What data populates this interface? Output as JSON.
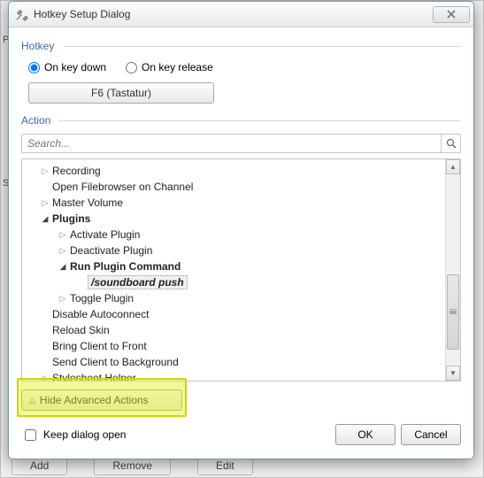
{
  "window": {
    "title": "Hotkey Setup Dialog"
  },
  "hotkey": {
    "section_label": "Hotkey",
    "opt_keydown": "On key down",
    "opt_keyrelease": "On key release",
    "selected": "keydown",
    "key_display": "F6 (Tastatur)"
  },
  "action": {
    "section_label": "Action",
    "search_placeholder": "Search...",
    "tree": [
      {
        "level": 0,
        "toggle": "closed",
        "label": "Recording"
      },
      {
        "level": 0,
        "toggle": "none",
        "label": "Open Filebrowser on Channel"
      },
      {
        "level": 0,
        "toggle": "closed",
        "label": "Master Volume"
      },
      {
        "level": 0,
        "toggle": "open",
        "label": "Plugins",
        "bold": true
      },
      {
        "level": 1,
        "toggle": "closed",
        "label": "Activate Plugin"
      },
      {
        "level": 1,
        "toggle": "closed",
        "label": "Deactivate Plugin"
      },
      {
        "level": 1,
        "toggle": "open",
        "label": "Run Plugin Command",
        "bold": true
      },
      {
        "level": 2,
        "toggle": "none",
        "label": "/soundboard push",
        "bold": true,
        "italic": true,
        "selected": true
      },
      {
        "level": 1,
        "toggle": "closed",
        "label": "Toggle Plugin"
      },
      {
        "level": 0,
        "toggle": "none",
        "label": "Disable Autoconnect"
      },
      {
        "level": 0,
        "toggle": "none",
        "label": "Reload Skin"
      },
      {
        "level": 0,
        "toggle": "none",
        "label": "Bring Client to Front"
      },
      {
        "level": 0,
        "toggle": "none",
        "label": "Send Client to Background"
      },
      {
        "level": 0,
        "toggle": "closed",
        "label": "Stylesheet Helper"
      }
    ],
    "toggle_advanced_label": "Hide Advanced Actions"
  },
  "footer": {
    "keep_open_label": "Keep dialog open",
    "ok_label": "OK",
    "cancel_label": "Cancel"
  },
  "backdrop": {
    "label_left_1": "Pr",
    "label_left_2": "S",
    "add_label": "Add",
    "remove_label": "Remove",
    "edit_label": "Edit"
  }
}
